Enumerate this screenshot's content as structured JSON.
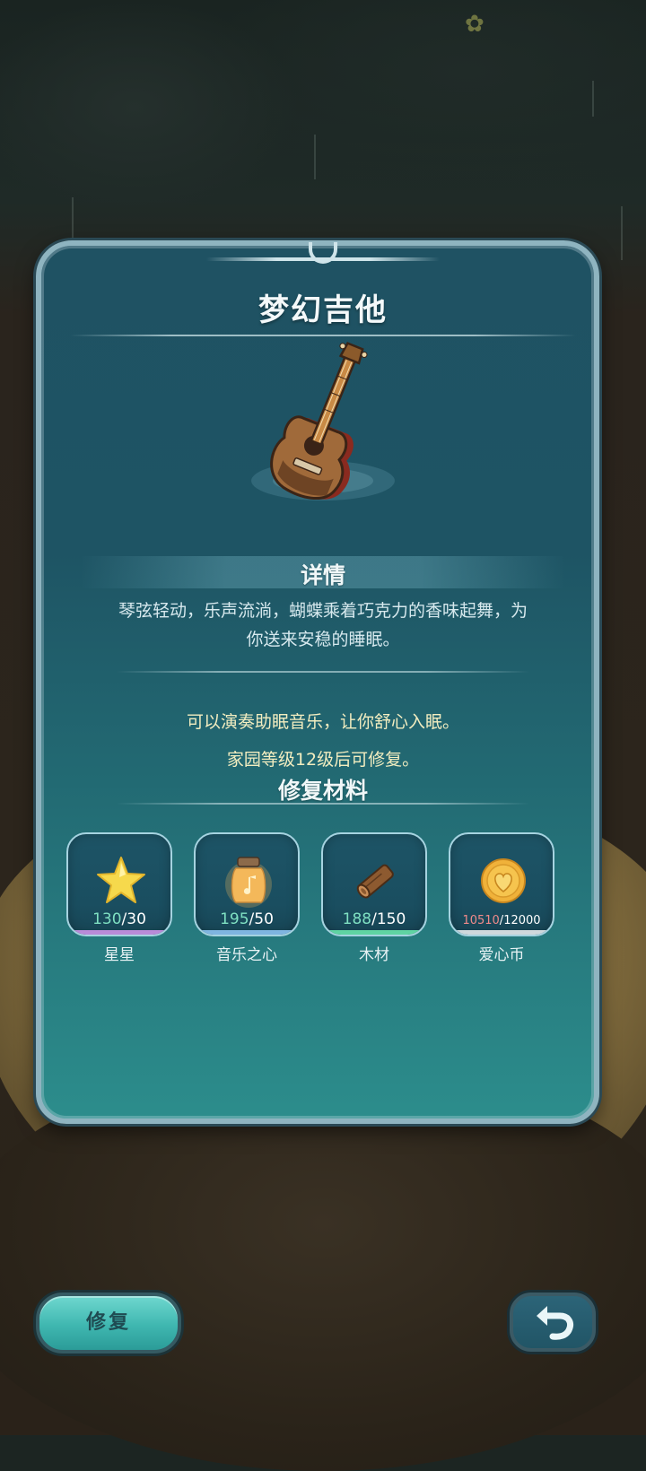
{
  "item": {
    "name": "梦幻吉他",
    "art_icon": "guitar-icon"
  },
  "details": {
    "heading": "详情",
    "description_line1": "琴弦轻动，乐声流淌，蝴蝶乘着巧克力的香味起舞，为",
    "description_line2": "你送来安稳的睡眠。",
    "effect": "可以演奏助眠音乐，让你舒心入眠。",
    "unlock_requirement": "家园等级12级后可修复。"
  },
  "materials": {
    "heading": "修复材料",
    "items": [
      {
        "name": "星星",
        "have": "130",
        "need": "30",
        "icon": "star-icon",
        "rim_color": "#b98bd8"
      },
      {
        "name": "音乐之心",
        "have": "195",
        "need": "50",
        "icon": "music-heart-jar-icon",
        "rim_color": "#7fb5e0"
      },
      {
        "name": "木材",
        "have": "188",
        "need": "150",
        "icon": "wood-log-icon",
        "rim_color": "#5fd3a2"
      },
      {
        "name": "爱心币",
        "have": "10510",
        "need": "12000",
        "icon": "heart-coin-icon",
        "rim_color": "#cfd8dc"
      }
    ]
  },
  "buttons": {
    "repair_label": "修复",
    "back_icon": "undo-arrow-icon"
  }
}
